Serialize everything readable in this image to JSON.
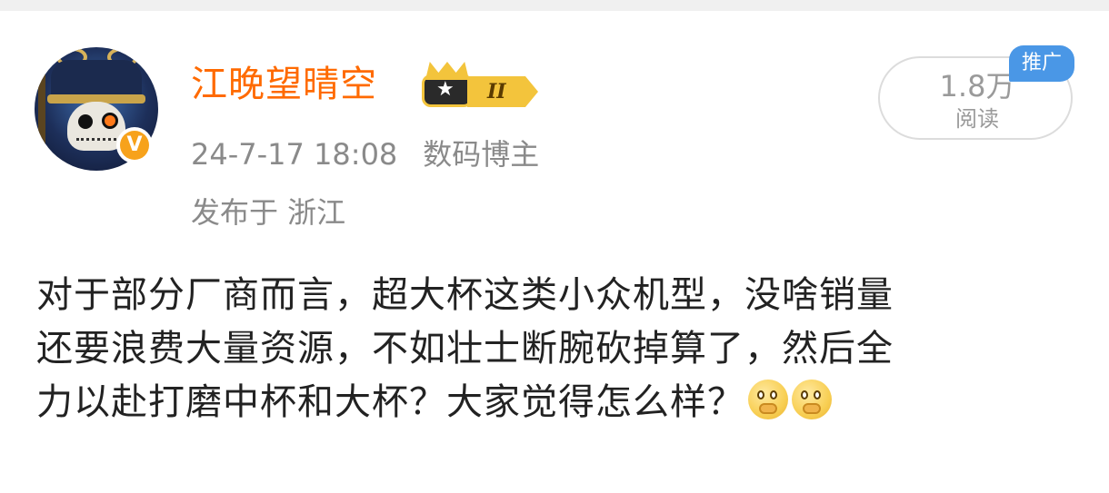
{
  "user": {
    "name": "江晚望晴空",
    "member_level": "II",
    "timestamp": "24-7-17 18:08",
    "role": "数码博主",
    "location": "发布于 浙江"
  },
  "stats": {
    "read_count": "1.8万",
    "read_label": "阅读",
    "promo_tag": "推广"
  },
  "post": {
    "lines": [
      "对于部分厂商而言，超大杯这类小众机型，没啥销量",
      "还要浪费大量资源，不如壮士断腕砍掉算了，然后全",
      "力以赴打磨中杯和大杯？大家觉得怎么样？"
    ],
    "emojis": [
      "thinking-face-icon",
      "thinking-face-icon"
    ]
  },
  "colors": {
    "username": "#ff6a00",
    "meta": "#8a8a8a",
    "promo": "#4a97e6",
    "verified": "#f7a21b"
  }
}
